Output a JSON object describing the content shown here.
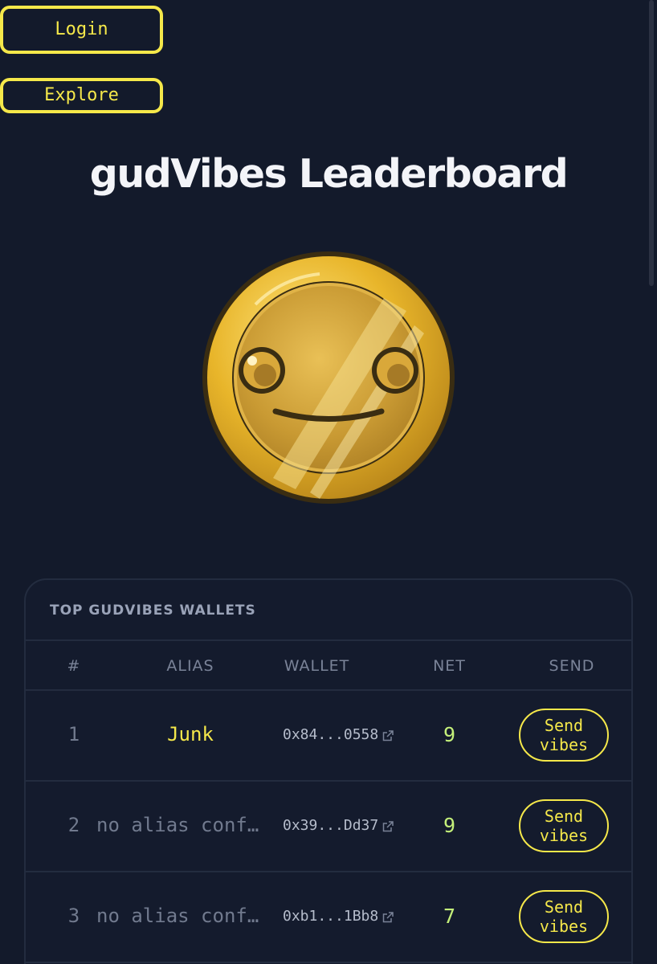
{
  "nav": {
    "login_label": "Login",
    "explore_label": "Explore"
  },
  "page": {
    "title": "gudVibes Leaderboard"
  },
  "leaderboard": {
    "title": "TOP GUDVIBES WALLETS",
    "columns": [
      "#",
      "ALIAS",
      "WALLET",
      "NET",
      "SEND"
    ],
    "rows": [
      {
        "rank": "1",
        "alias": "Junk",
        "wallet": "0x84...0558",
        "net": "9",
        "send_line1": "Send",
        "send_line2": "vibes"
      },
      {
        "rank": "2",
        "alias": "no alias conf…",
        "wallet": "0x39...Dd37",
        "net": "9",
        "send_line1": "Send",
        "send_line2": "vibes"
      },
      {
        "rank": "3",
        "alias": "no alias conf…",
        "wallet": "0xb1...1Bb8",
        "net": "7",
        "send_line1": "Send",
        "send_line2": "vibes"
      }
    ]
  },
  "icons": {
    "coin": "smiley-coin-icon",
    "wallet_link": "external-link-icon"
  },
  "colors": {
    "background": "#131a2b",
    "accent_yellow": "#f5e84a",
    "net_green": "#c4f07a",
    "muted_gray": "#717a8e"
  }
}
